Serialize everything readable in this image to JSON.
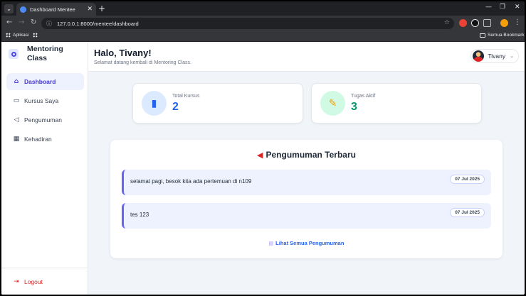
{
  "browser": {
    "tab_title": "Dashboard Mentee",
    "url": "127.0.0.1:8000/mentee/dashboard",
    "bookmarks": {
      "apps_label": "Aplikasi",
      "all_bookmarks_label": "Semua Bookmark"
    }
  },
  "app": {
    "brand_name": "Mentoring Class"
  },
  "sidebar": {
    "items": [
      {
        "label": "Dashboard",
        "icon": "home-icon",
        "active": true
      },
      {
        "label": "Kursus Saya",
        "icon": "book-icon",
        "active": false
      },
      {
        "label": "Pengumuman",
        "icon": "megaphone-icon",
        "active": false
      },
      {
        "label": "Kehadiran",
        "icon": "calendar-icon",
        "active": false
      }
    ],
    "logout_label": "Logout"
  },
  "header": {
    "greeting": "Halo, Tivany!",
    "subtitle": "Selamat datang kembali di Mentoring Class.",
    "user_name": "Tivany"
  },
  "stats": [
    {
      "label": "Total Kursus",
      "value": "2",
      "icon": "book-icon",
      "color": "#2563eb",
      "bg": "#dbeafe"
    },
    {
      "label": "Tugas Aktif",
      "value": "3",
      "icon": "memo-icon",
      "color": "#059669",
      "bg": "#d1fae5"
    }
  ],
  "announcements": {
    "title": "Pengumuman Terbaru",
    "items": [
      {
        "text": "selamat pagi, besok kita ada pertemuan di n109",
        "date": "07 Jul 2025"
      },
      {
        "text": "tes 123",
        "date": "07 Jul 2025"
      }
    ],
    "view_all_label": "Lihat Semua Pengumuman"
  },
  "colors": {
    "accent": "#4f46e5",
    "logout": "#dc2626"
  }
}
